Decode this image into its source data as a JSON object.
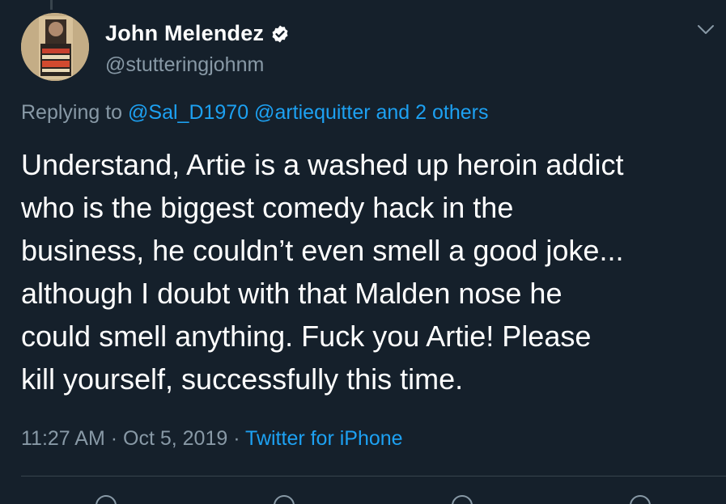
{
  "tweet": {
    "display_name": "John Melendez",
    "handle": "@stutteringjohnm",
    "avatar": {
      "icon": "book-cover-avatar",
      "cover_text": [
        "CANT FOR",
        "YOU TO SAY",
        "STUTTERING",
        "JOHN MELENDEZ"
      ]
    },
    "verified_icon": "verified-badge-icon",
    "menu_icon": "chevron-down-icon",
    "replying_to_prefix": "Replying to",
    "replying_to_mentions": "@Sal_D1970 @artiequitter and 2 others",
    "text": "Understand, Artie is a washed up heroin addict\nwho is the biggest comedy hack in the\nbusiness, he couldn’t even smell a good joke...\nalthough I doubt with that Malden nose he\ncould smell anything. Fuck you Artie! Please\nkill yourself, successfully this time.",
    "time": "11:27 AM",
    "separator": "·",
    "date": "Oct 5, 2019",
    "source": "Twitter for iPhone"
  },
  "colors": {
    "background": "#15202b",
    "text_primary": "#ffffff",
    "text_secondary": "#8899a6",
    "link": "#1da1f2",
    "divider": "#38444d"
  }
}
